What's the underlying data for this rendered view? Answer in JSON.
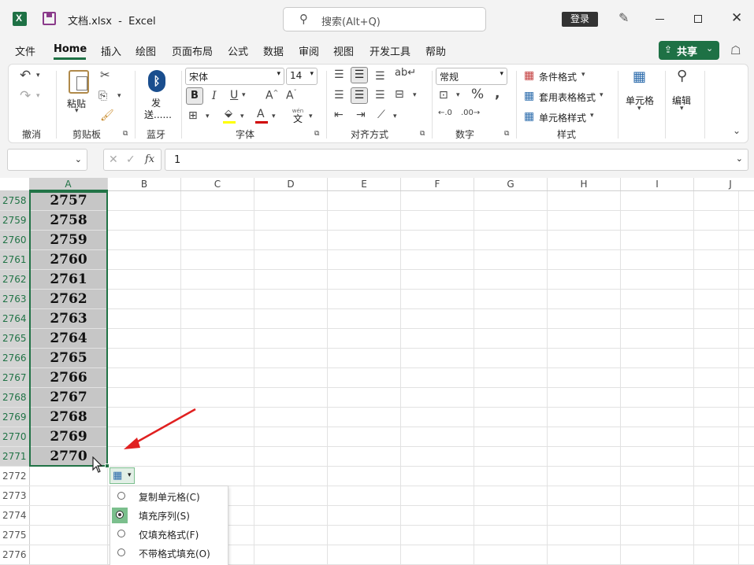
{
  "title_bar": {
    "app_icon": "excel-icon",
    "save_icon": "save-icon",
    "title": "文档.xlsx  -  Excel",
    "search_placeholder": "搜索(Alt+Q)",
    "login_label": "登录",
    "pen_icon": "pen-icon",
    "controls": [
      "minimize-icon",
      "maximize-icon",
      "close-icon"
    ]
  },
  "menu": {
    "items": [
      "文件",
      "Home",
      "插入",
      "绘图",
      "页面布局",
      "公式",
      "数据",
      "审阅",
      "视图",
      "开发工具",
      "帮助"
    ],
    "active": "Home",
    "share_label": "共享",
    "share_color": "#1e7145"
  },
  "ribbon": {
    "groups": {
      "undo": {
        "label": "撤消"
      },
      "clipboard": {
        "label": "剪贴板",
        "paste_label": "粘贴"
      },
      "bluetooth": {
        "label": "蓝牙",
        "send_label1": "发",
        "send_label2": "送......"
      },
      "font": {
        "label": "字体",
        "font_name": "宋体",
        "font_size": "14",
        "wen_label": "wén",
        "wen_char": "文"
      },
      "alignment": {
        "label": "对齐方式"
      },
      "number": {
        "label": "数字",
        "format": "常规"
      },
      "styles": {
        "label": "样式",
        "cond_format": "条件格式",
        "table_format": "套用表格格式",
        "cell_style": "单元格样式"
      },
      "cells": {
        "label": "单元格"
      },
      "editing": {
        "label": "编辑"
      }
    }
  },
  "formula_bar": {
    "name_box": "",
    "fx_label": "fx",
    "value": "1"
  },
  "sheet": {
    "columns": [
      "A",
      "B",
      "C",
      "D",
      "E",
      "F",
      "G",
      "H",
      "I",
      "J"
    ],
    "rows": [
      {
        "num": "2758",
        "a": "2757"
      },
      {
        "num": "2759",
        "a": "2758"
      },
      {
        "num": "2760",
        "a": "2759"
      },
      {
        "num": "2761",
        "a": "2760"
      },
      {
        "num": "2762",
        "a": "2761"
      },
      {
        "num": "2763",
        "a": "2762"
      },
      {
        "num": "2764",
        "a": "2763"
      },
      {
        "num": "2765",
        "a": "2764"
      },
      {
        "num": "2766",
        "a": "2765"
      },
      {
        "num": "2767",
        "a": "2766"
      },
      {
        "num": "2768",
        "a": "2767"
      },
      {
        "num": "2769",
        "a": "2768"
      },
      {
        "num": "2770",
        "a": "2769"
      },
      {
        "num": "2771",
        "a": "2770"
      },
      {
        "num": "2772",
        "a": ""
      },
      {
        "num": "2773",
        "a": ""
      },
      {
        "num": "2774",
        "a": ""
      },
      {
        "num": "2775",
        "a": ""
      },
      {
        "num": "2776",
        "a": ""
      }
    ],
    "selection_color": "#c6c6c6",
    "selection_border": "#217346"
  },
  "autofill": {
    "options": [
      {
        "label": "复制单元格(C)",
        "selected": false
      },
      {
        "label": "填充序列(S)",
        "selected": true
      },
      {
        "label": "仅填充格式(F)",
        "selected": false
      },
      {
        "label": "不带格式填充(O)",
        "selected": false
      }
    ],
    "arrow_color": "#e02020"
  }
}
